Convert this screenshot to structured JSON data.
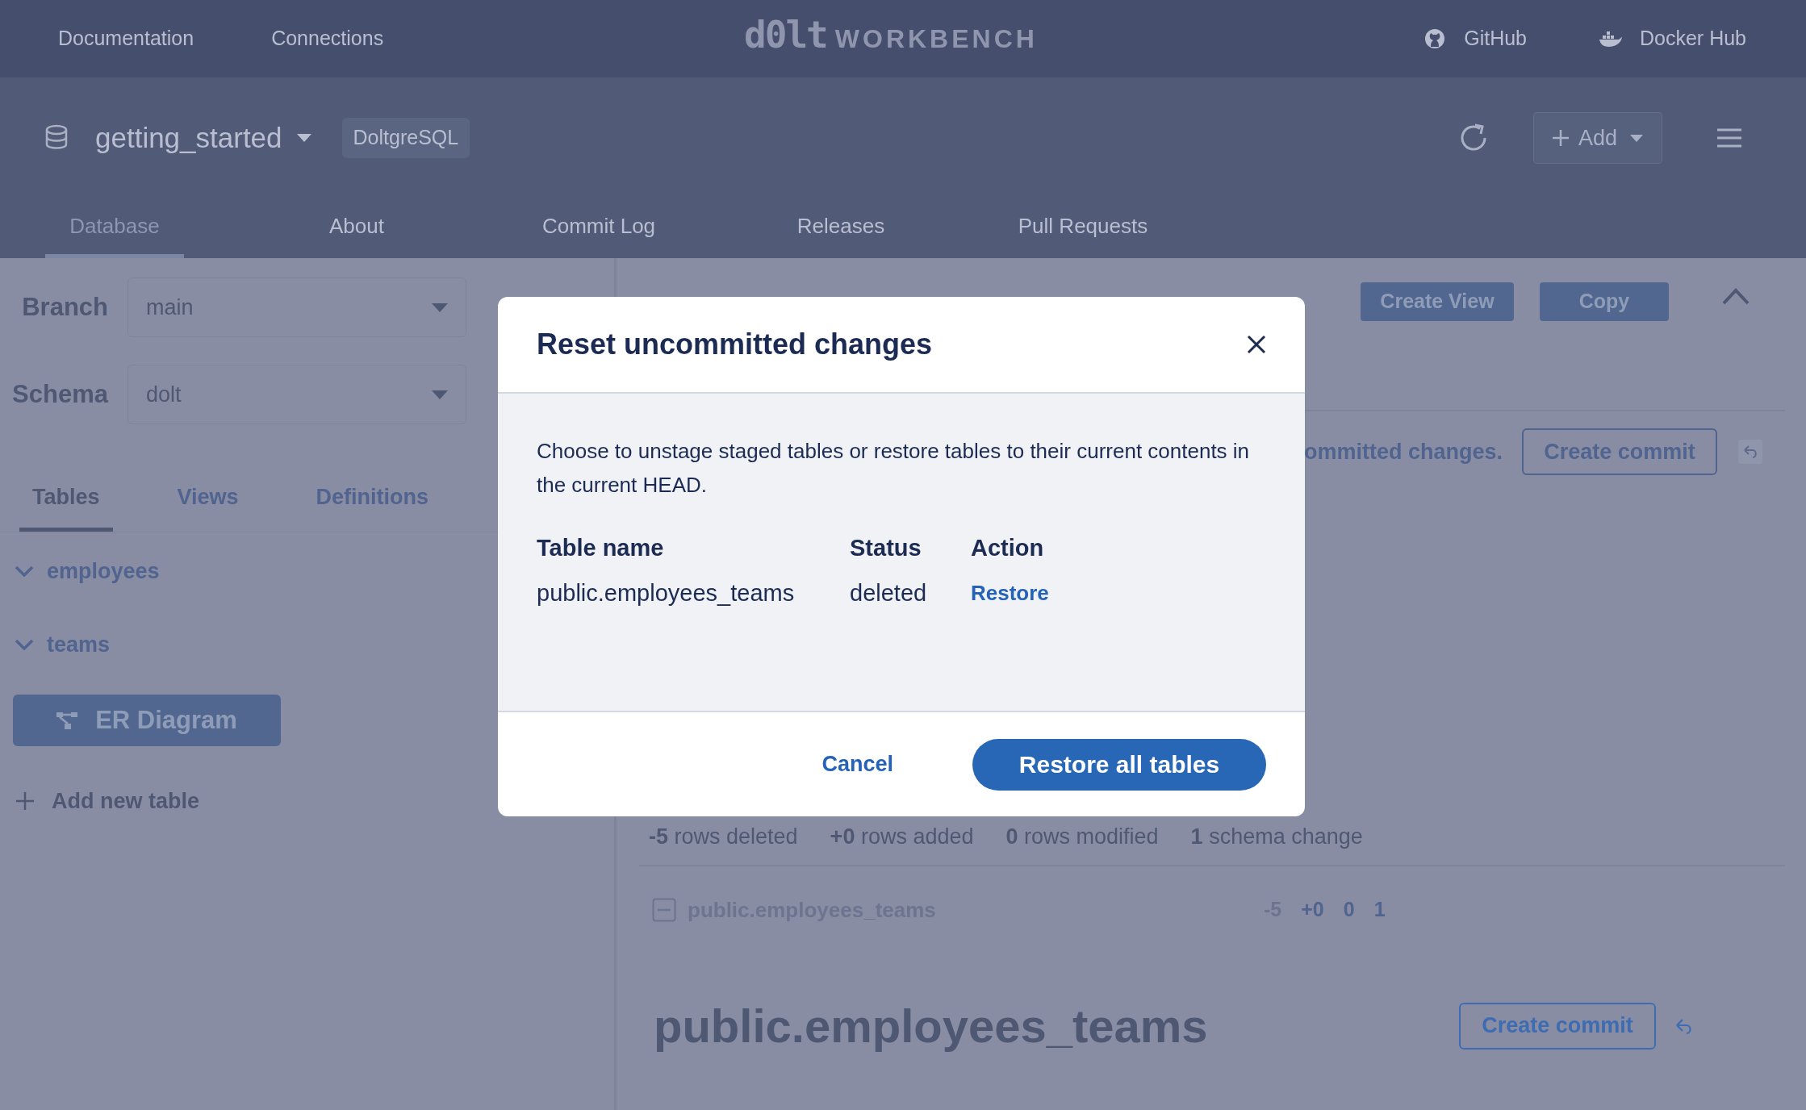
{
  "top_nav": {
    "left_links": [
      "Documentation",
      "Connections"
    ],
    "logo_mark": "d0lt",
    "logo_text": "WORKBENCH",
    "right_links": [
      {
        "label": "GitHub",
        "kind": "github"
      },
      {
        "label": "Docker Hub",
        "kind": "docker"
      }
    ]
  },
  "database_header": {
    "name": "getting_started",
    "badge": "DoltgreSQL",
    "add_button": "Add"
  },
  "tabs": [
    {
      "label": "Database",
      "selected": true
    },
    {
      "label": "About",
      "selected": false
    },
    {
      "label": "Commit Log",
      "selected": false
    },
    {
      "label": "Releases",
      "selected": false
    },
    {
      "label": "Pull Requests",
      "selected": false
    }
  ],
  "sidebar": {
    "branch": {
      "label": "Branch",
      "value": "main"
    },
    "schema": {
      "label": "Schema",
      "value": "dolt"
    },
    "tabs": [
      {
        "label": "Tables",
        "selected": true
      },
      {
        "label": "Views",
        "selected": false
      },
      {
        "label": "Definitions",
        "selected": false
      }
    ],
    "tables": [
      "employees",
      "teams"
    ],
    "er_button": "ER Diagram",
    "add_table": "Add new table"
  },
  "main": {
    "buttons": [
      "Create View",
      "Copy"
    ],
    "changes_note": "ommitted changes.",
    "create_commit": "Create commit",
    "summary": [
      "**-5** rows deleted",
      "**+0** rows added",
      "**0** rows modified",
      "**1** schema change"
    ],
    "diff_row": {
      "name": "public.employees_teams",
      "counts": [
        "-5",
        "+0",
        "0",
        "1"
      ]
    },
    "table_title": "public.employees_teams",
    "table_create_commit": "Create commit"
  },
  "modal": {
    "title": "Reset uncommitted changes",
    "description": "Choose to unstage staged tables or restore tables to their current contents in the current HEAD.",
    "columns": [
      "Table name",
      "Status",
      "Action"
    ],
    "rows": [
      {
        "table": "public.employees_teams",
        "status": "deleted",
        "action": "Restore"
      }
    ],
    "cancel": "Cancel",
    "confirm": "Restore all tables"
  }
}
